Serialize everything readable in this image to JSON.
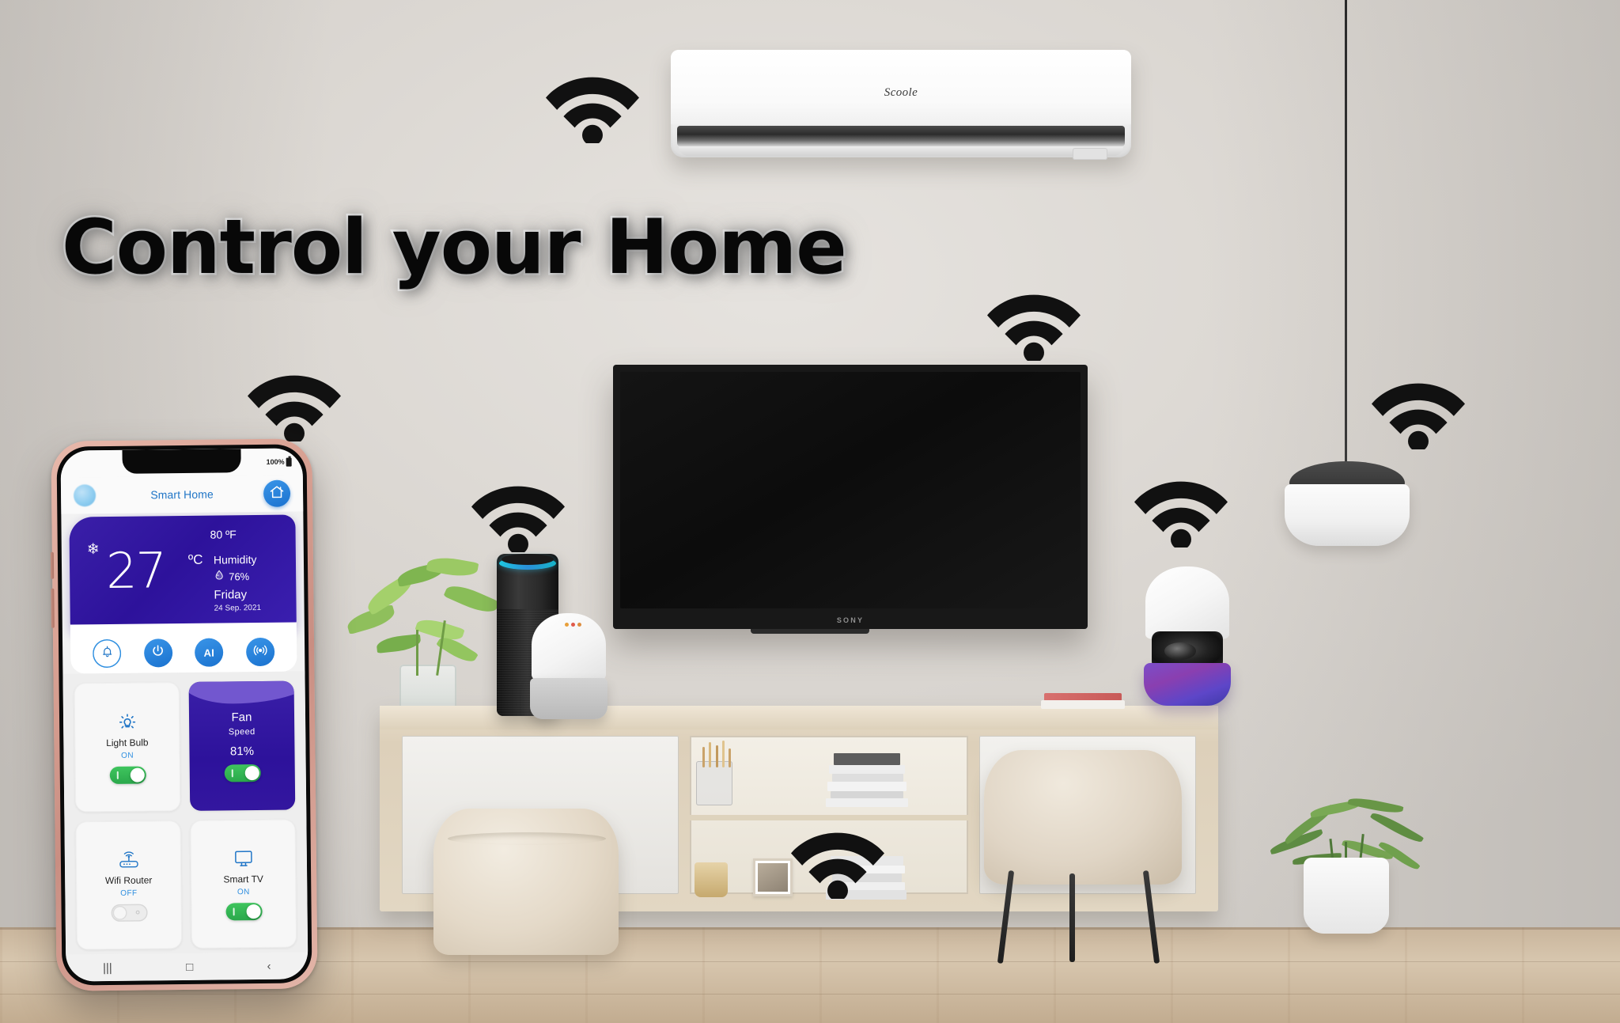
{
  "headline": "Control your Home",
  "scene": {
    "air_conditioner": {
      "brand": "Scoole",
      "sub_label": "air conditioner"
    },
    "tv": {
      "brand": "SONY"
    },
    "wifi_icon_name": "wifi-signal-icon",
    "wifi_icon_count": 7
  },
  "phone": {
    "status_bar": {
      "battery_text": "100%",
      "battery_icon": "battery-full-icon"
    },
    "header": {
      "title": "Smart Home",
      "left_icon": "blue-orb-icon",
      "home_button_icon": "home-icon"
    },
    "weather": {
      "snow_icon": "snowflake-icon",
      "temperature_c": "27",
      "unit_c": "ºC",
      "temperature_f": "80 ºF",
      "humidity_label": "Humidity",
      "humidity_icon": "water-drop-icon",
      "humidity_value": "76%",
      "day": "Friday",
      "date": "24 Sep. 2021"
    },
    "quick_actions": [
      {
        "name": "notifications",
        "icon": "bell-icon",
        "label": "",
        "style": "outline"
      },
      {
        "name": "power",
        "icon": "power-icon",
        "label": "",
        "style": "filled"
      },
      {
        "name": "ai-assistant",
        "icon": "ai-text",
        "label": "AI",
        "style": "filled"
      },
      {
        "name": "broadcast",
        "icon": "broadcast-icon",
        "label": "",
        "style": "filled"
      }
    ],
    "devices": [
      {
        "name": "light-bulb",
        "icon": "light-bulb-icon",
        "title": "Light Bulb",
        "state": "ON",
        "toggle": "on",
        "style": "light"
      },
      {
        "name": "fan",
        "icon": "",
        "title": "Fan",
        "state": "Speed",
        "value": "81%",
        "toggle": "on",
        "style": "purple"
      },
      {
        "name": "wifi-router",
        "icon": "router-icon",
        "title": "Wifi Router",
        "state": "OFF",
        "toggle": "off",
        "style": "light"
      },
      {
        "name": "smart-tv",
        "icon": "tv-icon",
        "title": "Smart TV",
        "state": "ON",
        "toggle": "on",
        "style": "light"
      }
    ],
    "nav_bar": [
      {
        "name": "recents",
        "glyph": "|||"
      },
      {
        "name": "home",
        "glyph": "□"
      },
      {
        "name": "back",
        "glyph": "‹"
      }
    ]
  },
  "colors": {
    "accent_blue": "#2176c7",
    "purple": "#2d129b",
    "toggle_green": "#2aa84b",
    "wall": "#dcd8d3",
    "floor": "#c9b59c"
  }
}
